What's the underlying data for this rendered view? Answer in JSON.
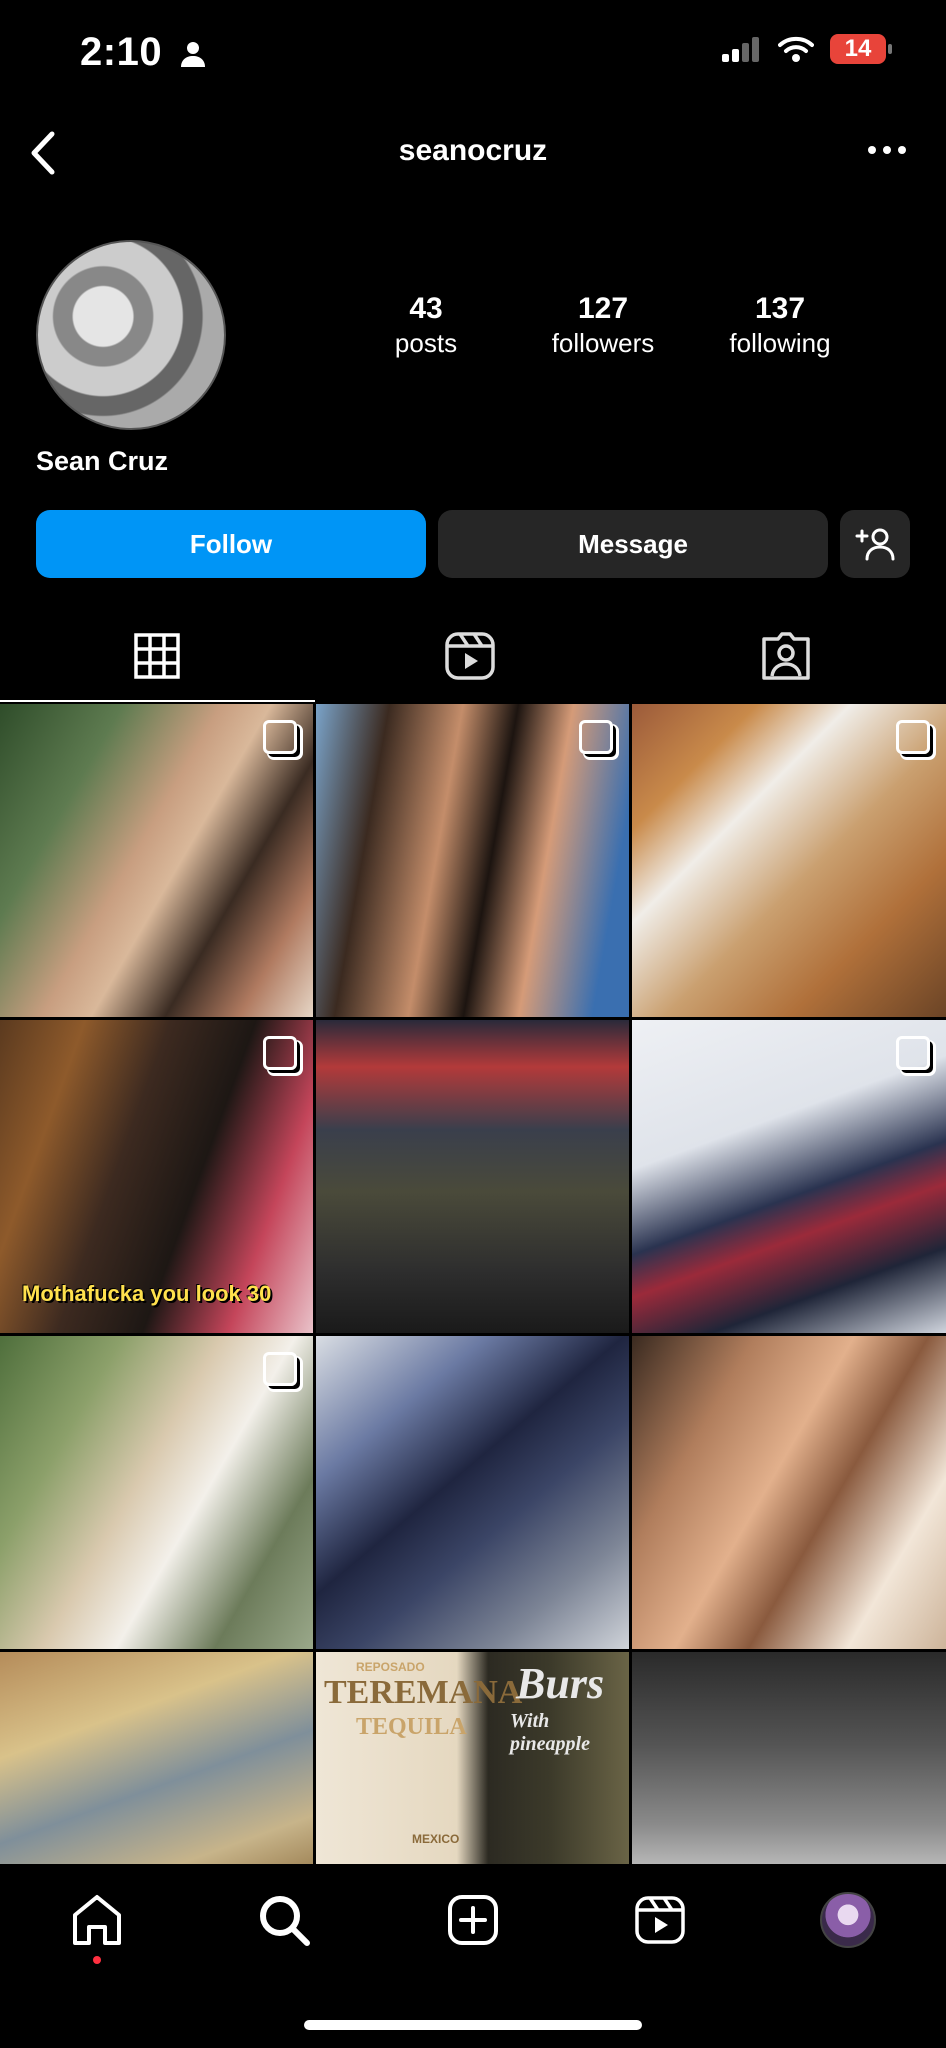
{
  "status_bar": {
    "time": "2:10",
    "battery": "14"
  },
  "header": {
    "username": "seanocruz"
  },
  "profile": {
    "display_name": "Sean Cruz",
    "stats": [
      {
        "num": "43",
        "label": "posts"
      },
      {
        "num": "127",
        "label": "followers"
      },
      {
        "num": "137",
        "label": "following"
      }
    ]
  },
  "actions": {
    "follow": "Follow",
    "message": "Message"
  },
  "tabs": [
    "grid-icon",
    "reels-icon",
    "tagged-icon"
  ],
  "grid": {
    "caption": "Mothafucka you look 30",
    "tile11": {
      "line1": "REPOSADO",
      "line2": "TEREMANA",
      "line3": "TEQUILA",
      "line4": "MEXICO",
      "line5": "Burs",
      "line6": "With pineapple"
    }
  },
  "colors": {
    "follow": "#0095f6",
    "dark_button": "#262626",
    "nav_dot": "#ff3040"
  }
}
